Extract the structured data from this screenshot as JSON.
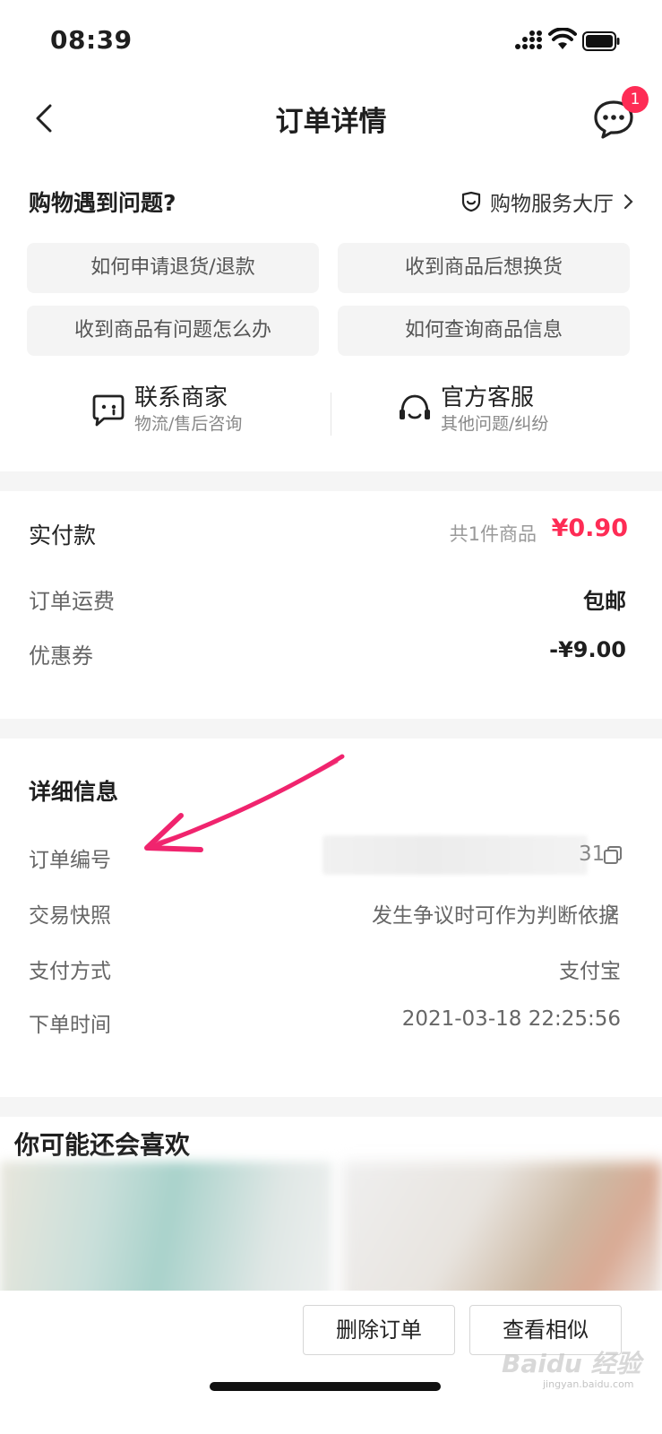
{
  "status_bar": {
    "time": "08:39"
  },
  "nav": {
    "title": "订单详情",
    "chat_badge": "1"
  },
  "help": {
    "title": "购物遇到问题?",
    "service_hall": "购物服务大厅",
    "faqs": [
      "如何申请退货/退款",
      "收到商品后想换货",
      "收到商品有问题怎么办",
      "如何查询商品信息"
    ],
    "contacts": [
      {
        "title": "联系商家",
        "subtitle": "物流/售后咨询"
      },
      {
        "title": "官方客服",
        "subtitle": "其他问题/纠纷"
      }
    ]
  },
  "payment": {
    "paid_label": "实付款",
    "item_count": "共1件商品",
    "paid_amount": "¥0.90",
    "shipping_label": "订单运费",
    "shipping_value": "包邮",
    "coupon_label": "优惠券",
    "coupon_value": "-¥9.00"
  },
  "details": {
    "title": "详细信息",
    "order_no_label": "订单编号",
    "order_no_tail": "31",
    "snapshot_label": "交易快照",
    "snapshot_value": "发生争议时可作为判断依据",
    "pay_method_label": "支付方式",
    "pay_method_value": "支付宝",
    "order_time_label": "下单时间",
    "order_time_value": "2021-03-18 22:25:56"
  },
  "recommend": {
    "title": "你可能还会喜欢"
  },
  "bottom": {
    "delete_label": "删除订单",
    "similar_label": "查看相似"
  },
  "watermark": {
    "text": "Baidu 经验",
    "sub": "jingyan.baidu.com"
  },
  "colors": {
    "accent": "#fe2c55",
    "background": "#f5f5f5",
    "annotation": "#f0246e"
  }
}
